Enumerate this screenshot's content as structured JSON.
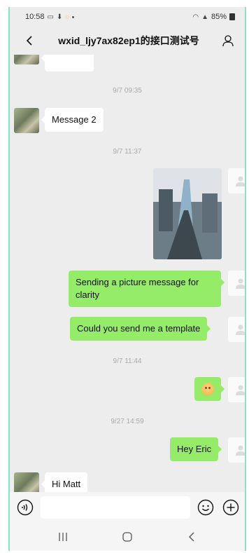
{
  "status_bar": {
    "time": "10:58",
    "battery": "85%"
  },
  "header": {
    "title": "wxid_ljy7ax82ep1的接口测试号"
  },
  "messages": {
    "ts1": "9/7 09:35",
    "msg2": "Message 2",
    "ts2": "9/7 11:37",
    "picture_msg": "Sending a picture message for clarity",
    "template_msg": "Could you send me a template",
    "ts3": "9/7 11:44",
    "ts4": "9/27 14:59",
    "hey_eric": "Hey Eric",
    "hi_matt": "Hi Matt"
  },
  "input": {
    "placeholder": ""
  },
  "icons": {
    "back": "chevron-left-icon",
    "profile": "person-icon",
    "voice": "voice-icon",
    "emoji": "smiley-icon",
    "plus": "plus-icon",
    "recents": "recents-icon",
    "home": "home-icon",
    "nav_back": "back-icon"
  },
  "colors": {
    "background": "#ededed",
    "green_bubble": "#95ec69",
    "white_bubble": "#ffffff",
    "timestamp": "#aaaaaa"
  }
}
